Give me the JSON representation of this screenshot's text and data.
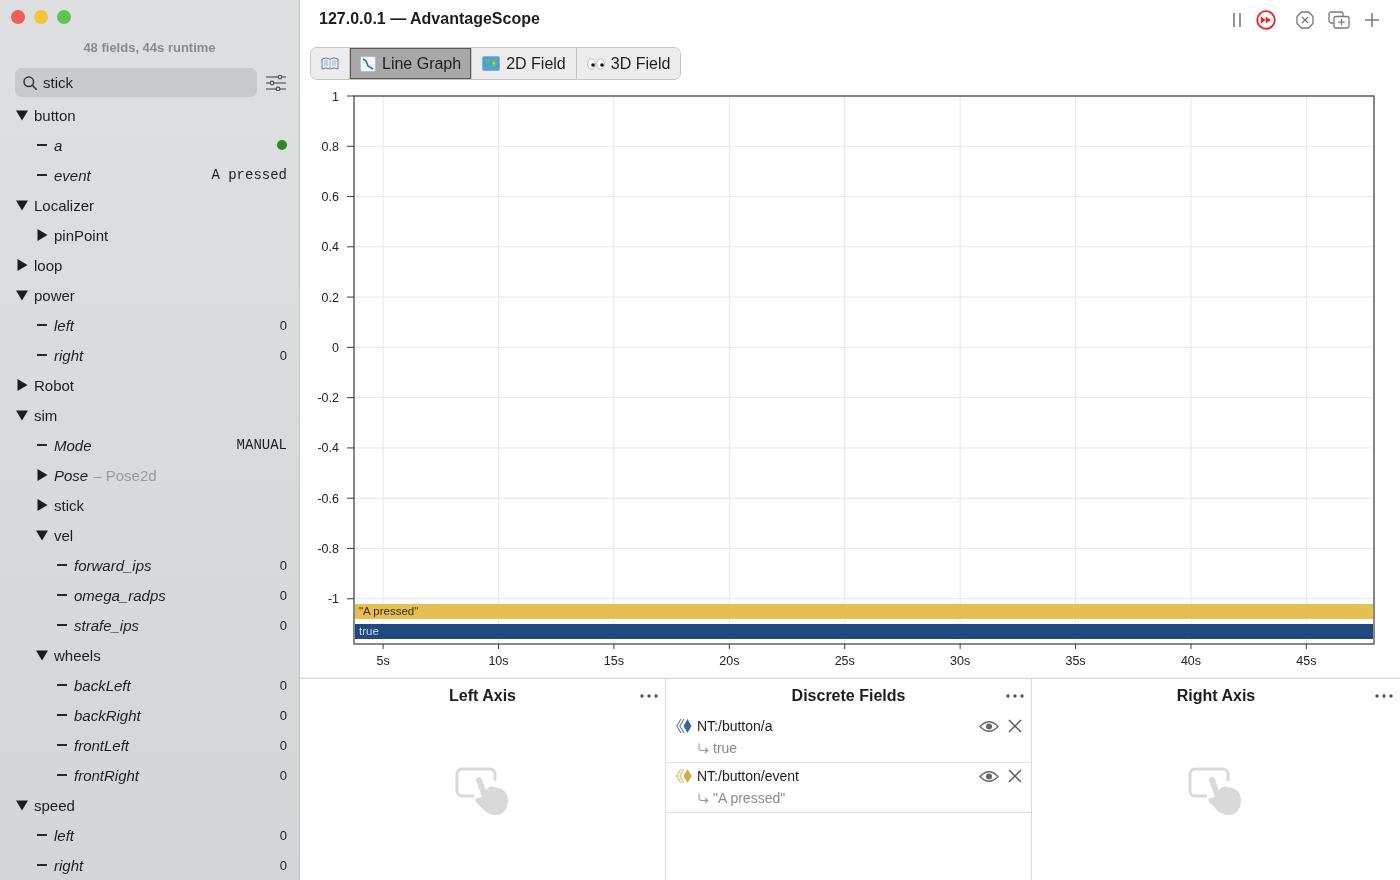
{
  "window": {
    "title": "127.0.0.1 — AdvantageScope"
  },
  "sidebar": {
    "status": "48 fields, 44s runtime",
    "search": {
      "value": "stick"
    },
    "tree": [
      {
        "name": "button",
        "kind": "folder",
        "expanded": true,
        "children": [
          {
            "name": "a",
            "kind": "boolean",
            "on": true
          },
          {
            "name": "event",
            "kind": "string",
            "value": "A pressed"
          }
        ]
      },
      {
        "name": "Localizer",
        "kind": "folder",
        "expanded": true,
        "children": [
          {
            "name": "pinPoint",
            "kind": "folder",
            "expanded": false
          }
        ]
      },
      {
        "name": "loop",
        "kind": "folder",
        "expanded": false
      },
      {
        "name": "power",
        "kind": "folder",
        "expanded": true,
        "children": [
          {
            "name": "left",
            "kind": "number",
            "value": "0"
          },
          {
            "name": "right",
            "kind": "number",
            "value": "0"
          }
        ]
      },
      {
        "name": "Robot",
        "kind": "folder",
        "expanded": false
      },
      {
        "name": "sim",
        "kind": "folder",
        "expanded": true,
        "children": [
          {
            "name": "Mode",
            "kind": "string",
            "value": "MANUAL"
          },
          {
            "name": "Pose",
            "kind": "struct",
            "expanded": false,
            "type_hint": "– Pose2d"
          },
          {
            "name": "stick",
            "kind": "folder",
            "expanded": false
          },
          {
            "name": "vel",
            "kind": "folder",
            "expanded": true,
            "children": [
              {
                "name": "forward_ips",
                "kind": "number",
                "value": "0"
              },
              {
                "name": "omega_radps",
                "kind": "number",
                "value": "0"
              },
              {
                "name": "strafe_ips",
                "kind": "number",
                "value": "0"
              }
            ]
          },
          {
            "name": "wheels",
            "kind": "folder",
            "expanded": true,
            "children": [
              {
                "name": "backLeft",
                "kind": "number",
                "value": "0"
              },
              {
                "name": "backRight",
                "kind": "number",
                "value": "0"
              },
              {
                "name": "frontLeft",
                "kind": "number",
                "value": "0"
              },
              {
                "name": "frontRight",
                "kind": "number",
                "value": "0"
              }
            ]
          }
        ]
      },
      {
        "name": "speed",
        "kind": "folder",
        "expanded": true,
        "children": [
          {
            "name": "left",
            "kind": "number",
            "value": "0"
          },
          {
            "name": "right",
            "kind": "number",
            "value": "0"
          }
        ]
      }
    ]
  },
  "tabs": [
    {
      "kind": "docs",
      "selected": false
    },
    {
      "kind": "line-graph",
      "label": "Line Graph",
      "selected": true
    },
    {
      "kind": "field-2d",
      "label": "2D Field",
      "selected": false
    },
    {
      "kind": "field-3d",
      "label": "3D Field",
      "selected": false
    }
  ],
  "chart": {
    "chart_data": {
      "type": "line",
      "grid": true,
      "xlim": [
        3.74,
        47.93
      ],
      "ylim": [
        -1.18,
        1
      ],
      "xticks": [
        {
          "value": 5,
          "label": "5s"
        },
        {
          "value": 10,
          "label": "10s"
        },
        {
          "value": 15,
          "label": "15s"
        },
        {
          "value": 20,
          "label": "20s"
        },
        {
          "value": 25,
          "label": "25s"
        },
        {
          "value": 30,
          "label": "30s"
        },
        {
          "value": 35,
          "label": "35s"
        },
        {
          "value": 40,
          "label": "40s"
        },
        {
          "value": 45,
          "label": "45s"
        }
      ],
      "yticks": [
        1,
        0.8,
        0.6,
        0.4,
        0.2,
        0,
        -0.2,
        -0.4,
        -0.6,
        -0.8,
        -1
      ]
    },
    "discrete_strips": [
      {
        "label": "\"A pressed\"",
        "color": "#e5bf4f"
      },
      {
        "label": "true",
        "color": "#21487f"
      }
    ]
  },
  "panels": [
    {
      "kind": "axis",
      "title": "Left Axis"
    },
    {
      "kind": "discrete",
      "title": "Discrete Fields",
      "fields": [
        {
          "name": "NT:/button/a",
          "value": "true",
          "color": "#3a64a8"
        },
        {
          "name": "NT:/button/event",
          "value": "\"A pressed\"",
          "color": "#d6ac3e"
        }
      ]
    },
    {
      "kind": "axis",
      "title": "Right Axis"
    }
  ]
}
